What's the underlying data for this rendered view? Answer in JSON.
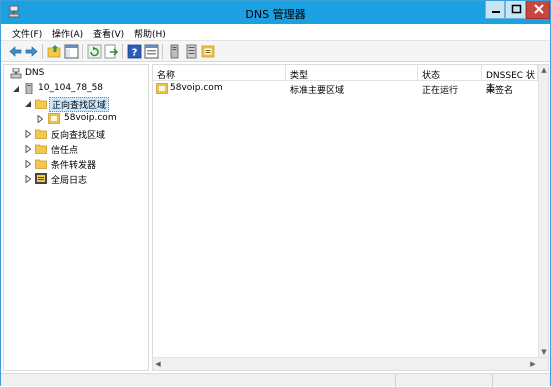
{
  "window": {
    "title": "DNS 管理器",
    "accent_color": "#1ba1e2"
  },
  "menu": {
    "items": [
      "文件(F)",
      "操作(A)",
      "查看(V)",
      "帮助(H)"
    ]
  },
  "toolbar": {
    "buttons": [
      "back-arrow-icon",
      "forward-arrow-icon",
      "up-folder-icon",
      "show-hide-tree-icon",
      "refresh-icon",
      "export-list-icon",
      "help-icon",
      "properties-icon",
      "server-icon",
      "server-list-icon",
      "zone-icon"
    ]
  },
  "tree": {
    "root": "DNS",
    "server": "10_104_78_58",
    "forward_zones": "正向查找区域",
    "zone": "58voip.com",
    "reverse_zones": "反向查找区域",
    "trust_points": "信任点",
    "conditional_forwarders": "条件转发器",
    "global_logs": "全局日志"
  },
  "list": {
    "columns": [
      "名称",
      "类型",
      "状态",
      "DNSSEC 状态"
    ],
    "rows": [
      {
        "name": "58voip.com",
        "type": "标准主要区域",
        "status": "正在运行",
        "dnssec": "未签名"
      }
    ]
  }
}
